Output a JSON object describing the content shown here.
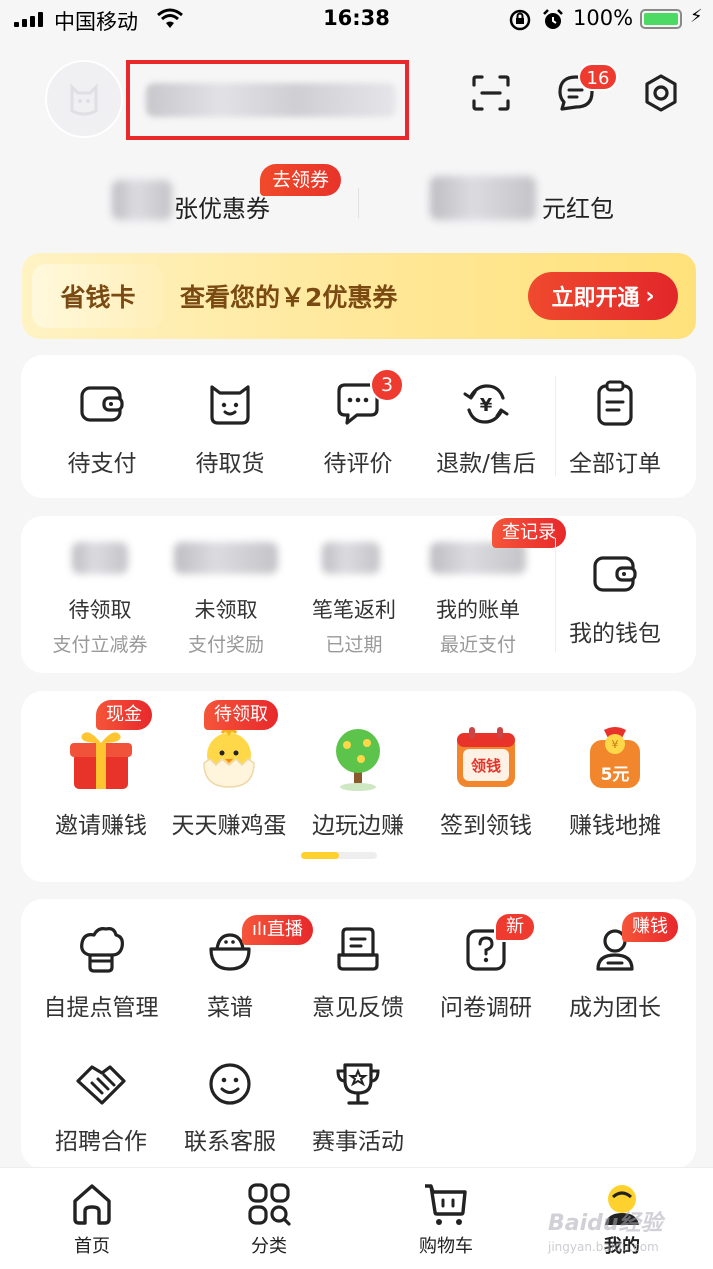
{
  "status_bar": {
    "carrier": "中国移动",
    "time": "16:38",
    "battery": "100%"
  },
  "header": {
    "username": "",
    "message_badge": "16"
  },
  "coupons": {
    "coupon_label": "张优惠券",
    "get_coupon": "去领券",
    "redpacket_label": "元红包"
  },
  "saving_card": {
    "tag": "省钱卡",
    "text": "查看您的￥2优惠券",
    "button": "立即开通"
  },
  "orders": {
    "items": [
      {
        "label": "待支付",
        "icon": "wallet-icon"
      },
      {
        "label": "待取货",
        "icon": "bag-icon"
      },
      {
        "label": "待评价",
        "icon": "chat-icon",
        "badge": "3"
      },
      {
        "label": "退款/售后",
        "icon": "refund-icon"
      },
      {
        "label": "全部订单",
        "icon": "clipboard-icon"
      }
    ]
  },
  "wallet_row": {
    "items": [
      {
        "label": "待领取",
        "sub": "支付立减券"
      },
      {
        "label": "未领取",
        "sub": "支付奖励"
      },
      {
        "label": "笔笔返利",
        "sub": "已过期"
      },
      {
        "label": "我的账单",
        "sub": "最近支付"
      }
    ],
    "records_badge": "查记录",
    "wallet_label": "我的钱包"
  },
  "earn_row": {
    "items": [
      {
        "label": "邀请赚钱",
        "tag": "现金",
        "icon": "gift-icon"
      },
      {
        "label": "天天赚鸡蛋",
        "tag": "待领取",
        "icon": "chick-icon"
      },
      {
        "label": "边玩边赚",
        "icon": "tree-icon"
      },
      {
        "label": "签到领钱",
        "icon": "calendar-icon",
        "icon_text": "领钱"
      },
      {
        "label": "赚钱地摊",
        "icon": "money-bag-icon",
        "icon_text": "5元"
      }
    ],
    "page_progress": 0.5
  },
  "services": {
    "items": [
      {
        "label": "自提点管理",
        "icon": "chef-hat-icon"
      },
      {
        "label": "菜谱",
        "icon": "bowl-icon",
        "tag": "直播"
      },
      {
        "label": "意见反馈",
        "icon": "feedback-icon"
      },
      {
        "label": "问卷调研",
        "icon": "question-icon",
        "tag": "新"
      },
      {
        "label": "成为团长",
        "icon": "person-icon",
        "tag": "赚钱"
      },
      {
        "label": "招聘合作",
        "icon": "handshake-icon"
      },
      {
        "label": "联系客服",
        "icon": "smile-icon"
      },
      {
        "label": "赛事活动",
        "icon": "trophy-icon"
      }
    ]
  },
  "tabbar": {
    "items": [
      {
        "label": "首页",
        "icon": "home-icon"
      },
      {
        "label": "分类",
        "icon": "grid-icon"
      },
      {
        "label": "购物车",
        "icon": "cart-icon"
      },
      {
        "label": "我的",
        "icon": "profile-icon"
      }
    ]
  },
  "colors": {
    "accent_red": "#e8282b",
    "gold": "#7a4a12",
    "yellow": "#ffd12e"
  },
  "watermark": {
    "brand": "Baidu经验",
    "url": "jingyan.baidu.com"
  }
}
